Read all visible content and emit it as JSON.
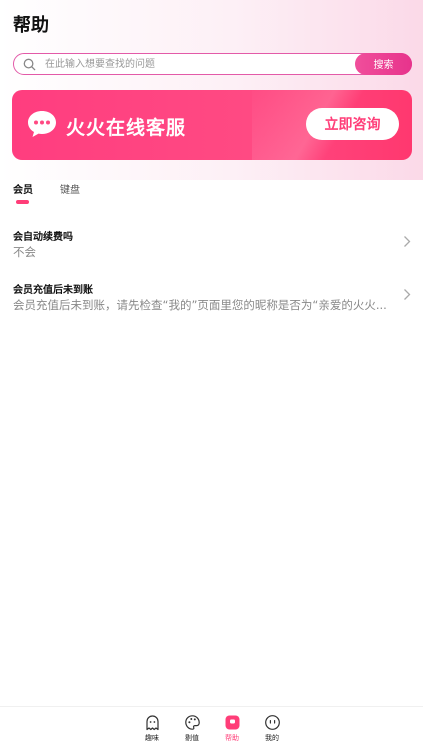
{
  "header": {
    "title": "帮助"
  },
  "search": {
    "placeholder": "在此输入想要查找的问题",
    "button_label": "搜索"
  },
  "banner": {
    "title": "火火在线客服",
    "button_label": "立即咨询"
  },
  "tabs": [
    {
      "label": "会员",
      "active": true
    },
    {
      "label": "键盘",
      "active": false
    }
  ],
  "faq": [
    {
      "question": "会自动续费吗",
      "answer": "不会"
    },
    {
      "question": "会员充值后未到账",
      "answer": "会员充值后未到账，请先检查“我的”页面里您的昵称是否为“亲爱的火火..."
    }
  ],
  "bottom_nav": [
    {
      "label": "趣味",
      "icon": "ghost-icon",
      "active": false
    },
    {
      "label": "剔值",
      "icon": "palette-icon",
      "active": false
    },
    {
      "label": "帮助",
      "icon": "help-icon",
      "active": true
    },
    {
      "label": "我的",
      "icon": "face-icon",
      "active": false
    }
  ],
  "colors": {
    "accent": "#ff3d78",
    "search_border": "#e35aa8",
    "banner": "#ff4a83"
  }
}
